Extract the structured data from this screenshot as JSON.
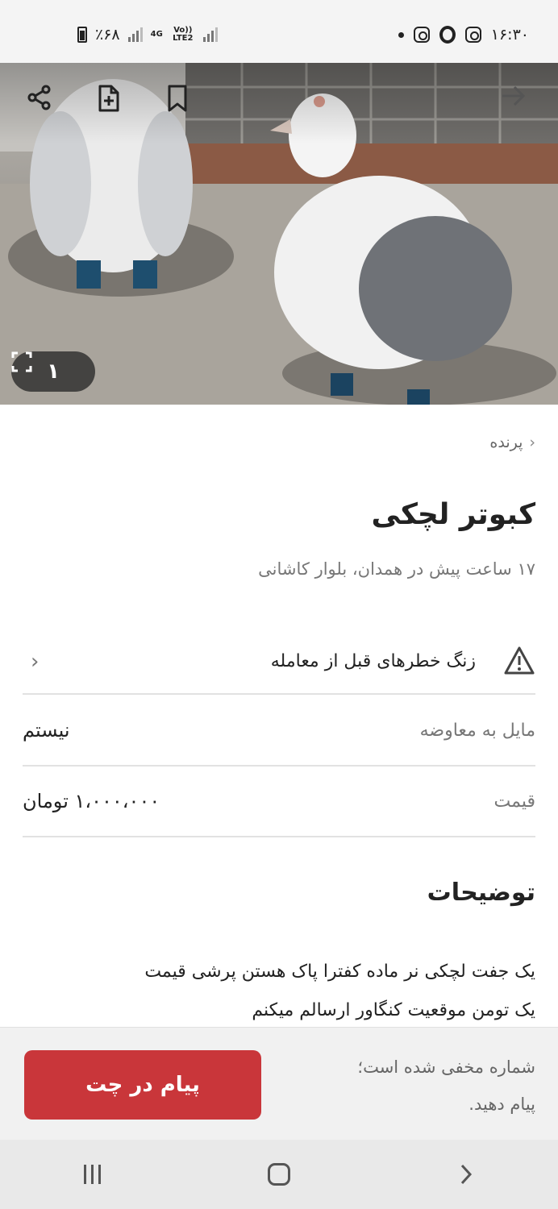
{
  "status_bar": {
    "battery": "٪۶۸",
    "network": "4G",
    "volte": "Vo)) LTE2",
    "time": "۱۶:۳۰"
  },
  "photo": {
    "image_count": "۱",
    "icons": [
      "share-icon",
      "add-note-icon",
      "bookmark-icon",
      "back-arrow-icon",
      "fullscreen-icon"
    ]
  },
  "listing": {
    "breadcrumb": "پرنده",
    "title": "کبوتر لچکی",
    "subtitle": "۱۷ ساعت پیش در همدان، بلوار کاشانی",
    "risk_label": "زنگ خطرهای قبل از معامله",
    "fields": [
      {
        "key": "مایل به معاوضه",
        "value": "نیستم"
      },
      {
        "key": "قیمت",
        "value": "۱،۰۰۰،۰۰۰ تومان"
      }
    ],
    "description_title": "توضیحات",
    "description_lines": [
      "یک جفت لچکی نر ماده  کفترا پاک هستن پرشی قیمت",
      "یک تومن موقعیت کنگاور ارسالم میکنم"
    ]
  },
  "action_bar": {
    "hidden_note_line1": "شماره مخفی شده است؛",
    "hidden_note_line2": "پیام دهید.",
    "chat_button": "پیام در چت"
  },
  "colors": {
    "accent": "#c9363a",
    "muted_text": "#777777",
    "divider": "#e2e2e2"
  }
}
